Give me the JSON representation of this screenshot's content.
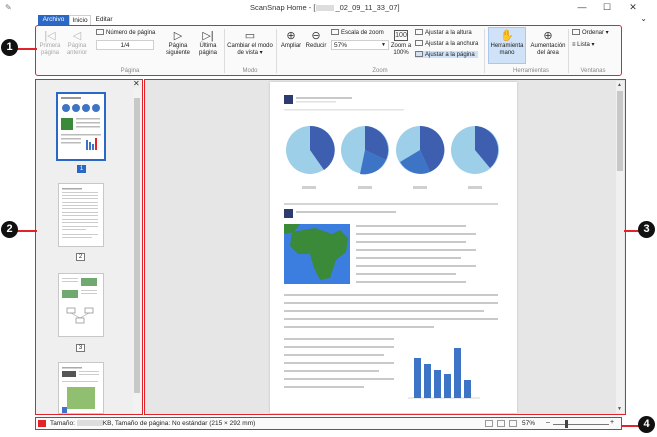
{
  "window": {
    "title": "ScanSnap Home - [",
    "title_suffix": "_02_09_11_33_07]",
    "minimize": "—",
    "maximize": "☐",
    "close": "✕"
  },
  "tabs": {
    "file": "Archivo",
    "home": "Inicio",
    "edit": "Editar",
    "collapse": "⌄"
  },
  "ribbon": {
    "page_group": {
      "label": "Página",
      "first": "Primera página",
      "previous": "Página anterior",
      "page_number_label": "Número de página",
      "page_number_value": "1/4",
      "next": "Página siguiente",
      "last": "Última página"
    },
    "mode_group": {
      "label": "Modo",
      "change_view": "Cambiar el modo de vista"
    },
    "zoom_group": {
      "label": "Zoom",
      "zoom_in": "Ampliar",
      "zoom_out": "Reducir",
      "zoom_scale_label": "Escala de zoom",
      "zoom_value": "57%",
      "zoom_100": "Zoom a 100%",
      "fit_height": "Ajustar a la altura",
      "fit_width": "Ajustar a la anchura",
      "fit_page": "Ajustar a la página"
    },
    "tools_group": {
      "label": "Herramientas",
      "hand": "Herramienta mano",
      "area_zoom": "Aumentación del área"
    },
    "windows_group": {
      "label": "Ventanas",
      "arrange": "Ordenar",
      "list": "Lista"
    }
  },
  "thumbnails": {
    "close": "✕",
    "items": [
      {
        "number": "1",
        "selected": true
      },
      {
        "number": "2",
        "selected": false
      },
      {
        "number": "3",
        "selected": false
      }
    ]
  },
  "status": {
    "size_label": "Tamaño:",
    "size_value": "KB, Tamaño de página: No estándar (215 × 292 mm)",
    "zoom": "57%",
    "minus": "–",
    "plus": "+"
  },
  "callouts": [
    "1",
    "2",
    "3",
    "4"
  ],
  "colors": {
    "accent": "#2b67c5",
    "callout_border": "#e0242a",
    "chart_blue": "#3d74c6",
    "map_green": "#3a8a3a"
  }
}
